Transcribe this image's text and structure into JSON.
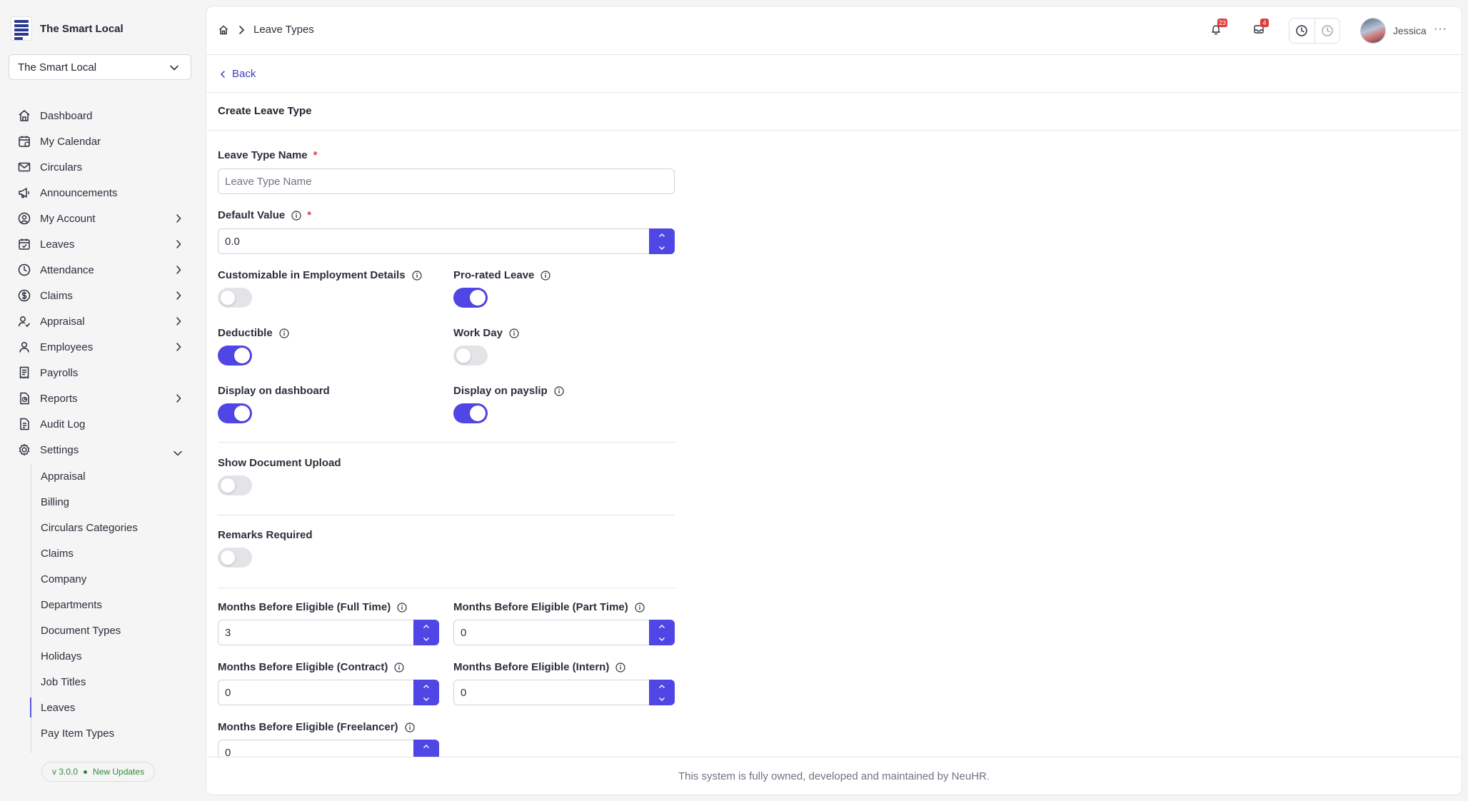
{
  "brand": {
    "name": "The Smart Local",
    "logo_text": "THE SMART LOCAL"
  },
  "org_select": {
    "value": "The Smart Local"
  },
  "nav": [
    {
      "label": "Dashboard",
      "icon": "home-icon"
    },
    {
      "label": "My Calendar",
      "icon": "calendar-icon"
    },
    {
      "label": "Circulars",
      "icon": "mail-icon"
    },
    {
      "label": "Announcements",
      "icon": "megaphone-icon"
    },
    {
      "label": "My Account",
      "icon": "user-circle-icon",
      "expandable": true
    },
    {
      "label": "Leaves",
      "icon": "calendar-check-icon",
      "expandable": true
    },
    {
      "label": "Attendance",
      "icon": "clock-icon",
      "expandable": true
    },
    {
      "label": "Claims",
      "icon": "dollar-icon",
      "expandable": true
    },
    {
      "label": "Appraisal",
      "icon": "user-check-icon",
      "expandable": true
    },
    {
      "label": "Employees",
      "icon": "user-icon",
      "expandable": true
    },
    {
      "label": "Payrolls",
      "icon": "receipt-icon"
    },
    {
      "label": "Reports",
      "icon": "report-icon",
      "expandable": true
    },
    {
      "label": "Audit Log",
      "icon": "audit-icon"
    },
    {
      "label": "Settings",
      "icon": "gear-icon",
      "expanded": true
    }
  ],
  "settings_sub": [
    "Appraisal",
    "Billing",
    "Circulars Categories",
    "Claims",
    "Company",
    "Departments",
    "Document Types",
    "Holidays",
    "Job Titles",
    "Leaves",
    "Pay Item Types"
  ],
  "settings_active": "Leaves",
  "version": {
    "number": "v 3.0.0",
    "status": "New Updates"
  },
  "breadcrumb": {
    "current": "Leave Types"
  },
  "topbar": {
    "notifications_count": "23",
    "inbox_count": "4",
    "user_name": "Jessica",
    "more": "···"
  },
  "back_label": "Back",
  "page_title": "Create Leave Type",
  "form": {
    "leave_type_name": {
      "label": "Leave Type Name",
      "required": "*",
      "placeholder": "Leave Type Name",
      "value": ""
    },
    "default_value": {
      "label": "Default Value",
      "required": "*",
      "value": "0.0"
    },
    "toggles": {
      "customizable": {
        "label": "Customizable in Employment Details",
        "on": false
      },
      "pro_rated": {
        "label": "Pro-rated Leave",
        "on": true
      },
      "deductible": {
        "label": "Deductible",
        "on": true
      },
      "work_day": {
        "label": "Work Day",
        "on": false
      },
      "display_dashboard": {
        "label": "Display on dashboard",
        "on": true
      },
      "display_payslip": {
        "label": "Display on payslip",
        "on": true
      },
      "show_document_upload": {
        "label": "Show Document Upload",
        "on": false
      },
      "remarks_required": {
        "label": "Remarks Required",
        "on": false
      }
    },
    "eligibility": {
      "full_time": {
        "label": "Months Before Eligible (Full Time)",
        "value": "3"
      },
      "part_time": {
        "label": "Months Before Eligible (Part Time)",
        "value": "0"
      },
      "contract": {
        "label": "Months Before Eligible (Contract)",
        "value": "0"
      },
      "intern": {
        "label": "Months Before Eligible (Intern)",
        "value": "0"
      },
      "freelancer": {
        "label": "Months Before Eligible (Freelancer)",
        "value": "0"
      }
    }
  },
  "footer": "This system is fully owned, developed and maintained by NeuHR.",
  "colors": {
    "accent": "#4f46e5",
    "link": "#3a3fb8",
    "badge": "#e03b3b",
    "version_green": "#2e8b3a"
  }
}
